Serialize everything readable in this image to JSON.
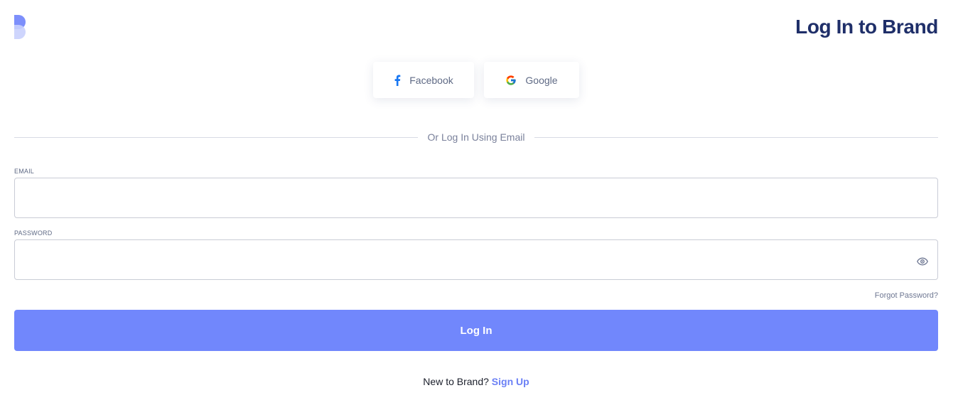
{
  "header": {
    "logo_icon": "brand-logo-icon",
    "title": "Log In to Brand"
  },
  "social": {
    "facebook_label": "Facebook",
    "facebook_icon": "facebook-icon",
    "google_label": "Google",
    "google_icon": "google-icon"
  },
  "divider": {
    "label": "Or Log In Using Email"
  },
  "form": {
    "email_label": "EMAIL",
    "email_value": "",
    "password_label": "PASSWORD",
    "password_value": "",
    "password_toggle_icon": "eye-icon",
    "forgot_label": "Forgot Password?",
    "submit_label": "Log In"
  },
  "footer": {
    "prompt": "New to Brand?",
    "signup_label": "Sign Up"
  },
  "colors": {
    "accent": "#7187fc",
    "title": "#1f2f69",
    "link": "#6b80f5",
    "facebook": "#1877f2"
  }
}
